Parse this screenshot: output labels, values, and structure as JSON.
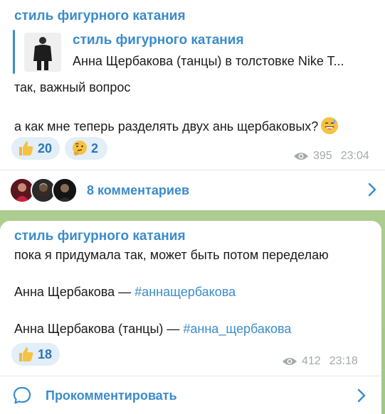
{
  "colors": {
    "accent": "#3a8ccb",
    "reaction_bg": "#e2eef8",
    "meta": "#a2a9ae"
  },
  "message1": {
    "channel": "стиль фигурного катания",
    "reply": {
      "title": "стиль фигурного катания",
      "text": "Анна Щербакова (танцы) в толстовке Nike T..."
    },
    "line1": "так, важный вопрос",
    "line2": "а как мне теперь разделять двух ань щербаковых?",
    "line2_emoji": "sweat-smile-emoji",
    "reactions": [
      {
        "emoji": "thumbs-up-emoji",
        "count": "20"
      },
      {
        "emoji": "thinking-face-emoji",
        "count": "2"
      }
    ],
    "views": "395",
    "time": "23:04",
    "comments_label": "8 комментариев"
  },
  "message2": {
    "channel": "стиль фигурного катания",
    "line1": "пока я придумала так, может быть потом переделаю",
    "tag1_name": "Анна Щербакова — ",
    "tag1_hashtag": "#аннащербакова",
    "tag2_name": "Анна Щербакова (танцы) — ",
    "tag2_hashtag": "#анна_щербакова",
    "reactions": [
      {
        "emoji": "thumbs-up-emoji",
        "count": "18"
      }
    ],
    "views": "412",
    "time": "23:18",
    "comment_action": "Прокомментировать"
  }
}
